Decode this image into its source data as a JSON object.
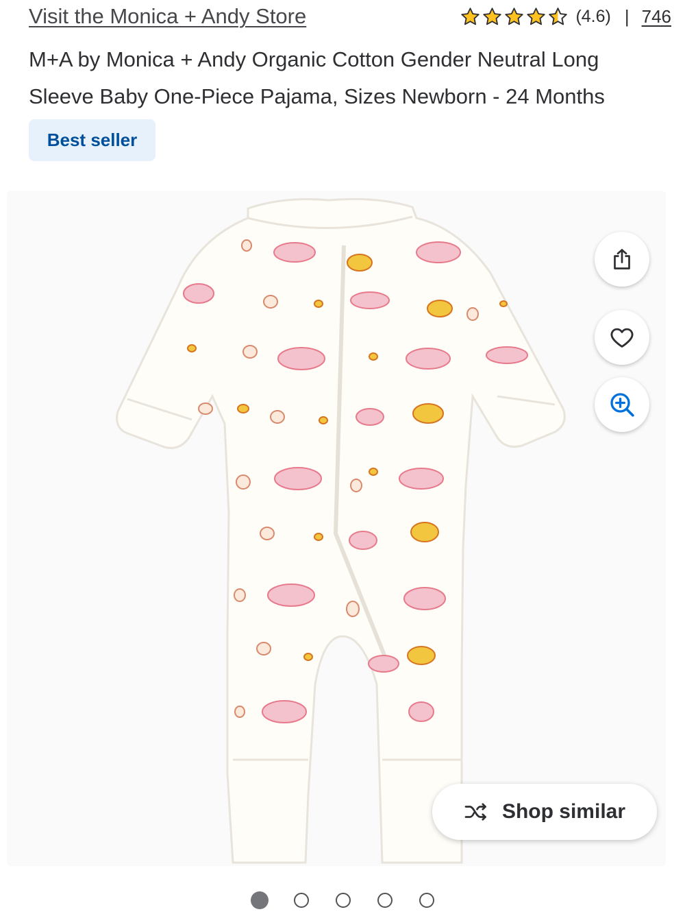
{
  "store": {
    "link_label": "Visit the Monica + Andy Store"
  },
  "rating": {
    "value_text": "(4.6)",
    "separator": "|",
    "review_count": "746",
    "stars": 4.6,
    "star_color": "#ffc220"
  },
  "product": {
    "title": "M+A by Monica + Andy Organic Cotton Gender Neutral Long Sleeve Baby One-Piece Pajama, Sizes Newborn - 24 Months"
  },
  "badge": {
    "label": "Best seller",
    "background": "#e6f1fc",
    "color": "#004f9a"
  },
  "image_actions": {
    "share_icon": "share-icon",
    "favorite_icon": "heart-icon",
    "zoom_icon": "zoom-in-icon",
    "zoom_color": "#0071dc"
  },
  "shop_similar": {
    "label": "Shop similar",
    "icon": "shuffle-icon"
  },
  "carousel": {
    "total": 5,
    "active_index": 0
  }
}
